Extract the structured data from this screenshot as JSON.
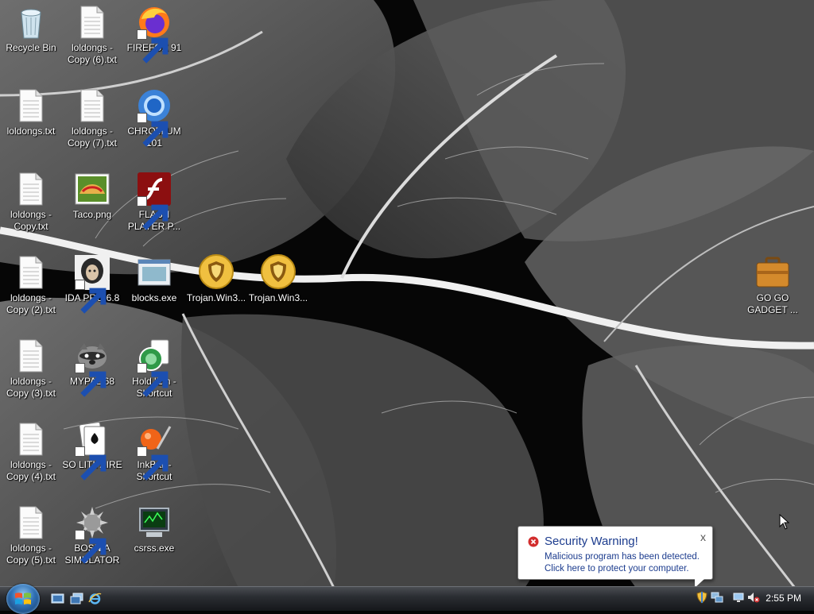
{
  "desktop": {
    "icons": [
      {
        "label": "Recycle Bin",
        "type": "recycle-bin-icon",
        "shortcut": false
      },
      {
        "label": "loldongs - Copy (6).txt",
        "type": "text-file-icon",
        "shortcut": false
      },
      {
        "label": "FIREFOX 91",
        "type": "firefox-icon",
        "shortcut": true
      },
      {
        "label": "loldongs.txt",
        "type": "text-file-icon",
        "shortcut": false
      },
      {
        "label": "loldongs - Copy (7).txt",
        "type": "text-file-icon",
        "shortcut": false
      },
      {
        "label": "CHROMIUM 101",
        "type": "chromium-icon",
        "shortcut": true
      },
      {
        "label": "loldongs - Copy.txt",
        "type": "text-file-icon",
        "shortcut": false
      },
      {
        "label": "Taco.png",
        "type": "image-file-icon",
        "shortcut": false
      },
      {
        "label": "FLASH PLAYER P...",
        "type": "flash-player-icon",
        "shortcut": true
      },
      {
        "label": "loldongs - Copy (2).txt",
        "type": "text-file-icon",
        "shortcut": false
      },
      {
        "label": "IDA PRO 6.8",
        "type": "ida-pro-icon",
        "shortcut": true
      },
      {
        "label": "blocks.exe",
        "type": "exe-file-icon",
        "shortcut": false
      },
      {
        "label": "Trojan.Win3...",
        "type": "shield-icon",
        "shortcut": false
      },
      {
        "label": "Trojan.Win3...",
        "type": "shield-icon",
        "shortcut": false
      },
      {
        "label": "loldongs - Copy (3).txt",
        "type": "text-file-icon",
        "shortcut": false
      },
      {
        "label": "MYPAL 68",
        "type": "raccoon-icon",
        "shortcut": true
      },
      {
        "label": "Hold 'Em - Shortcut",
        "type": "poker-chips-icon",
        "shortcut": true
      },
      {
        "label": "loldongs - Copy (4).txt",
        "type": "text-file-icon",
        "shortcut": false
      },
      {
        "label": "SO LIT!! AIRE",
        "type": "solitaire-icon",
        "shortcut": true
      },
      {
        "label": "InkBall - Shortcut",
        "type": "inkball-icon",
        "shortcut": true
      },
      {
        "label": "loldongs - Copy (5).txt",
        "type": "text-file-icon",
        "shortcut": false
      },
      {
        "label": "BOSNIA SIMULATOR",
        "type": "spiky-ball-icon",
        "shortcut": true
      },
      {
        "label": "csrss.exe",
        "type": "monitor-icon",
        "shortcut": false
      },
      {
        "label": "GO GO GADGET ...",
        "type": "briefcase-icon",
        "shortcut": false
      }
    ]
  },
  "balloon": {
    "title": "Security Warning!",
    "line1": "Malicious program has been detected.",
    "line2": "Click here to protect your computer.",
    "close": "x"
  },
  "taskbar": {
    "start_icon": "windows-logo-icon",
    "quick_launch": [
      "show-desktop-icon",
      "switch-windows-icon",
      "internet-explorer-icon"
    ],
    "tray_icons": [
      "security-shield-icon",
      "network-computers-icon",
      "network-icon",
      "volume-muted-icon"
    ],
    "clock": "2:55 PM"
  }
}
